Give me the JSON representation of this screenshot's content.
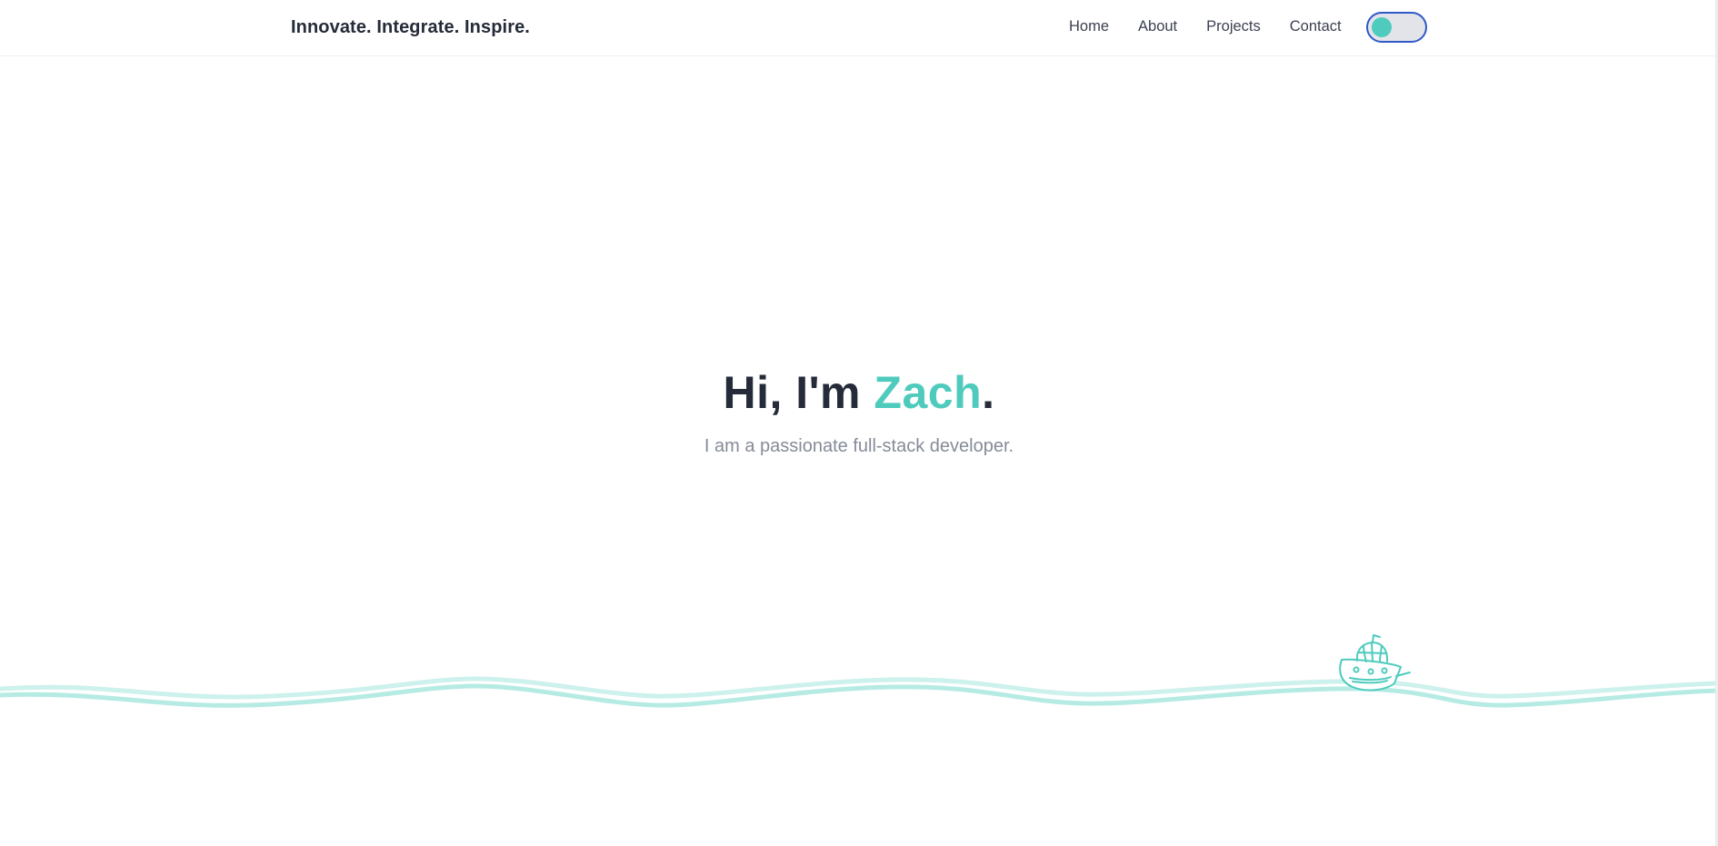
{
  "navbar": {
    "brand": "Innovate. Integrate. Inspire.",
    "links": [
      {
        "label": "Home"
      },
      {
        "label": "About"
      },
      {
        "label": "Projects"
      },
      {
        "label": "Contact"
      }
    ],
    "theme_toggle": {
      "state": "light",
      "knob_color": "#4ecbbd",
      "track_color": "#e3e4ea",
      "border_color": "#2f58c9"
    }
  },
  "hero": {
    "greeting_prefix": "Hi, I'm ",
    "name": "Zach",
    "greeting_suffix": ".",
    "subtitle": "I am a passionate full-stack developer."
  },
  "colors": {
    "accent": "#4ecbbd",
    "text_dark": "#252b39",
    "text_muted": "#858b98",
    "wave": "#b6ebe4"
  },
  "decor": {
    "boat_icon": "boat-icon",
    "wave_icon": "wave-icon"
  }
}
